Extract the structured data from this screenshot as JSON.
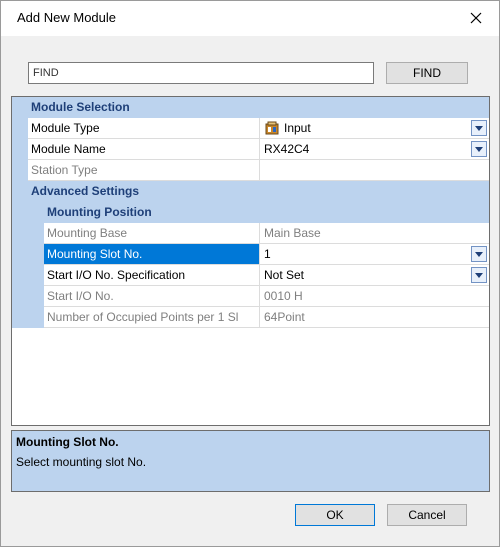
{
  "window": {
    "title": "Add New Module"
  },
  "search": {
    "value": "FIND",
    "button_label": "FIND"
  },
  "grid": {
    "module_selection_label": "Module Selection",
    "module_type": {
      "name": "Module Type",
      "value": "Input",
      "icon": "input-module-icon"
    },
    "module_name": {
      "name": "Module Name",
      "value": "RX42C4"
    },
    "station_type": {
      "name": "Station Type",
      "value": ""
    },
    "advanced_settings_label": "Advanced Settings",
    "mounting_position_label": "Mounting Position",
    "mounting_base": {
      "name": "Mounting Base",
      "value": "Main Base"
    },
    "mounting_slot": {
      "name": "Mounting Slot No.",
      "value": "1"
    },
    "start_io_spec": {
      "name": "Start I/O No. Specification",
      "value": "Not Set"
    },
    "start_io": {
      "name": "Start I/O No.",
      "value": "0010 H"
    },
    "occupied_points": {
      "name": "Number of Occupied Points per 1 Sl",
      "value": "64Point"
    }
  },
  "description": {
    "title": "Mounting Slot No.",
    "text": "Select mounting slot No."
  },
  "buttons": {
    "ok": "OK",
    "cancel": "Cancel"
  },
  "colors": {
    "category_bg": "#bcd3ee",
    "selection": "#0078d7",
    "category_text": "#1e3f78"
  }
}
